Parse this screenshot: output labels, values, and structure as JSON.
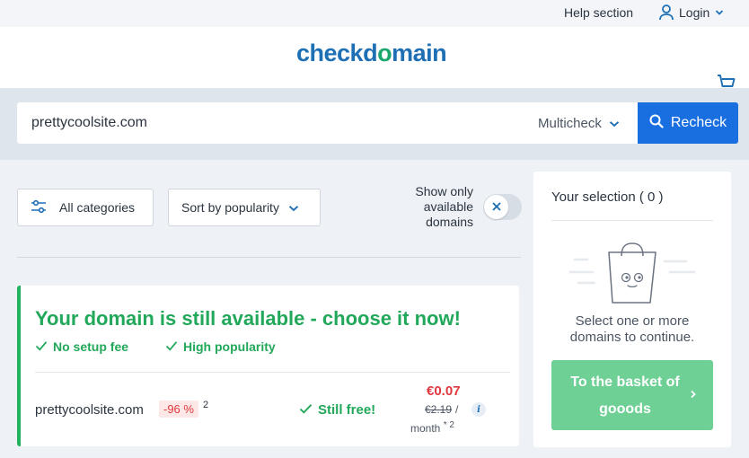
{
  "topbar": {
    "help": "Help section",
    "login": "Login"
  },
  "brand": {
    "logo_part1": "check",
    "logo_o": "o",
    "logo_part2": "main",
    "logo_d": "d"
  },
  "search": {
    "query": "prettycoolsite.com",
    "mode": "Multicheck",
    "button": "Recheck"
  },
  "filters": {
    "categories": "All categories",
    "sort": "Sort by popularity",
    "available_line1": "Show only",
    "available_line2": "available",
    "available_line3": "domains"
  },
  "result": {
    "title": "Your domain is still available - choose it now!",
    "feature1": "No setup fee",
    "feature2": "High popularity",
    "domain": "prettycoolsite.com",
    "discount": "-96 %",
    "footnote": "2",
    "status": "Still free!",
    "price": "€0.07",
    "old_price": "€2.19",
    "slash": "/",
    "per": "month",
    "per_note": "* 2",
    "info": "i"
  },
  "selection": {
    "title": "Your selection ( 0 )",
    "note": "Select one or more domains to continue.",
    "button_line1": "To the basket of",
    "button_line2": "gooods"
  },
  "colors": {
    "brand_blue": "#1f6fb5",
    "accent_green": "#22a85a",
    "cta_blue": "#1a6fe0",
    "sale_red": "#e0383e"
  }
}
